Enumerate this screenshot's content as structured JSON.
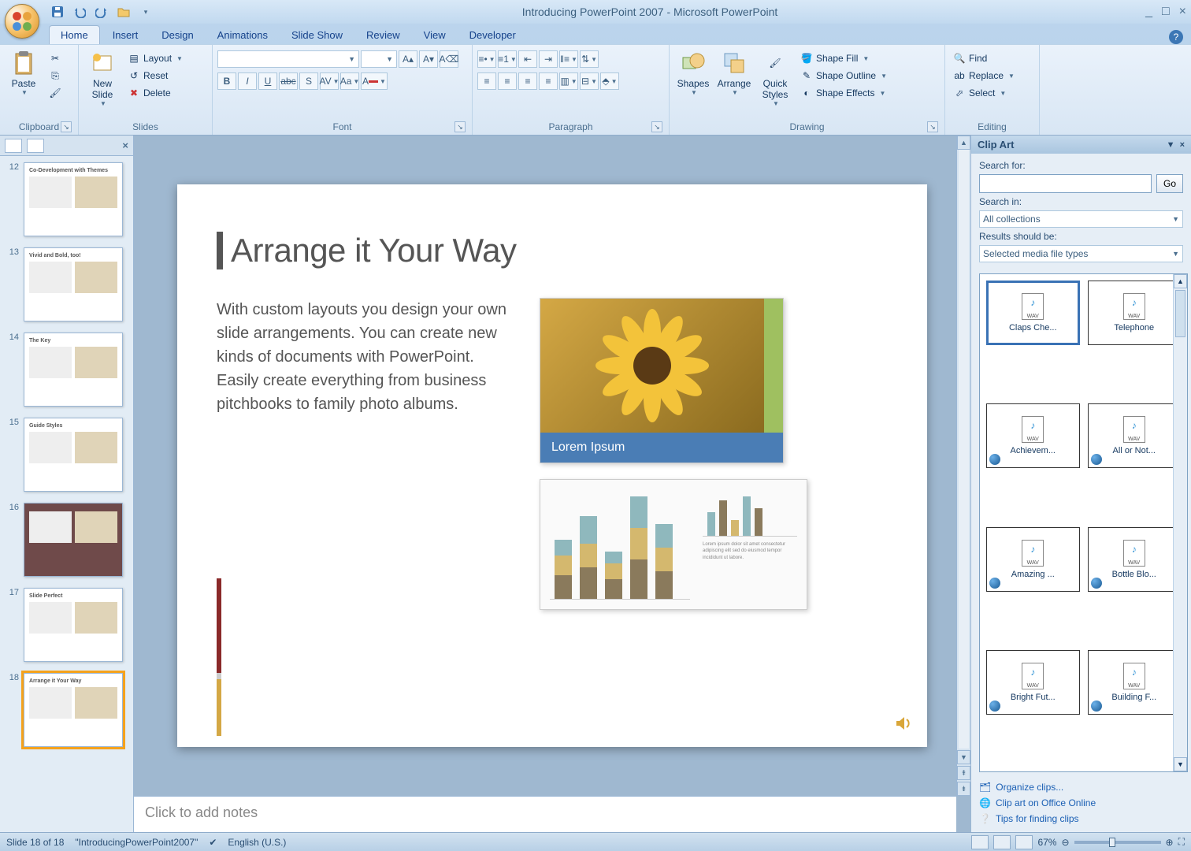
{
  "title": "Introducing PowerPoint 2007 - Microsoft PowerPoint",
  "tabs": [
    "Home",
    "Insert",
    "Design",
    "Animations",
    "Slide Show",
    "Review",
    "View",
    "Developer"
  ],
  "activeTab": 0,
  "ribbon": {
    "clipboard": {
      "paste": "Paste",
      "label": "Clipboard"
    },
    "slides": {
      "new": "New\nSlide",
      "layout": "Layout",
      "reset": "Reset",
      "delete": "Delete",
      "label": "Slides"
    },
    "font": {
      "label": "Font"
    },
    "paragraph": {
      "label": "Paragraph"
    },
    "drawing": {
      "shapes": "Shapes",
      "arrange": "Arrange",
      "quick": "Quick\nStyles",
      "fill": "Shape Fill",
      "outline": "Shape Outline",
      "effects": "Shape Effects",
      "label": "Drawing"
    },
    "editing": {
      "find": "Find",
      "replace": "Replace",
      "select": "Select",
      "label": "Editing"
    }
  },
  "thumbs": [
    {
      "n": 12,
      "t": "Co-Development with Themes"
    },
    {
      "n": 13,
      "t": "Vivid and Bold, too!"
    },
    {
      "n": 14,
      "t": "The Key"
    },
    {
      "n": 15,
      "t": "Guide Styles"
    },
    {
      "n": 16,
      "t": "",
      "dark": true
    },
    {
      "n": 17,
      "t": "Slide Perfect"
    },
    {
      "n": 18,
      "t": "Arrange it Your Way",
      "selected": true
    }
  ],
  "slide": {
    "title": "Arrange it Your Way",
    "body": "With custom layouts you design your own slide arrangements. You can create new kinds of documents with PowerPoint. Easily create everything from business pitchbooks to family photo albums.",
    "caption": "Lorem Ipsum"
  },
  "notesPlaceholder": "Click to add notes",
  "clipart": {
    "title": "Clip Art",
    "searchFor": "Search for:",
    "go": "Go",
    "searchIn": "Search in:",
    "searchInVal": "All collections",
    "resultsShould": "Results should be:",
    "resultsVal": "Selected media file types",
    "items": [
      "Claps Che...",
      "Telephone",
      "Achievem...",
      "All or Not...",
      "Amazing ...",
      "Bottle Blo...",
      "Bright Fut...",
      "Building F..."
    ],
    "links": [
      "Organize clips...",
      "Clip art on Office Online",
      "Tips for finding clips"
    ]
  },
  "status": {
    "slide": "Slide 18 of 18",
    "file": "\"IntroducingPowerPoint2007\"",
    "lang": "English (U.S.)",
    "zoom": "67%"
  }
}
